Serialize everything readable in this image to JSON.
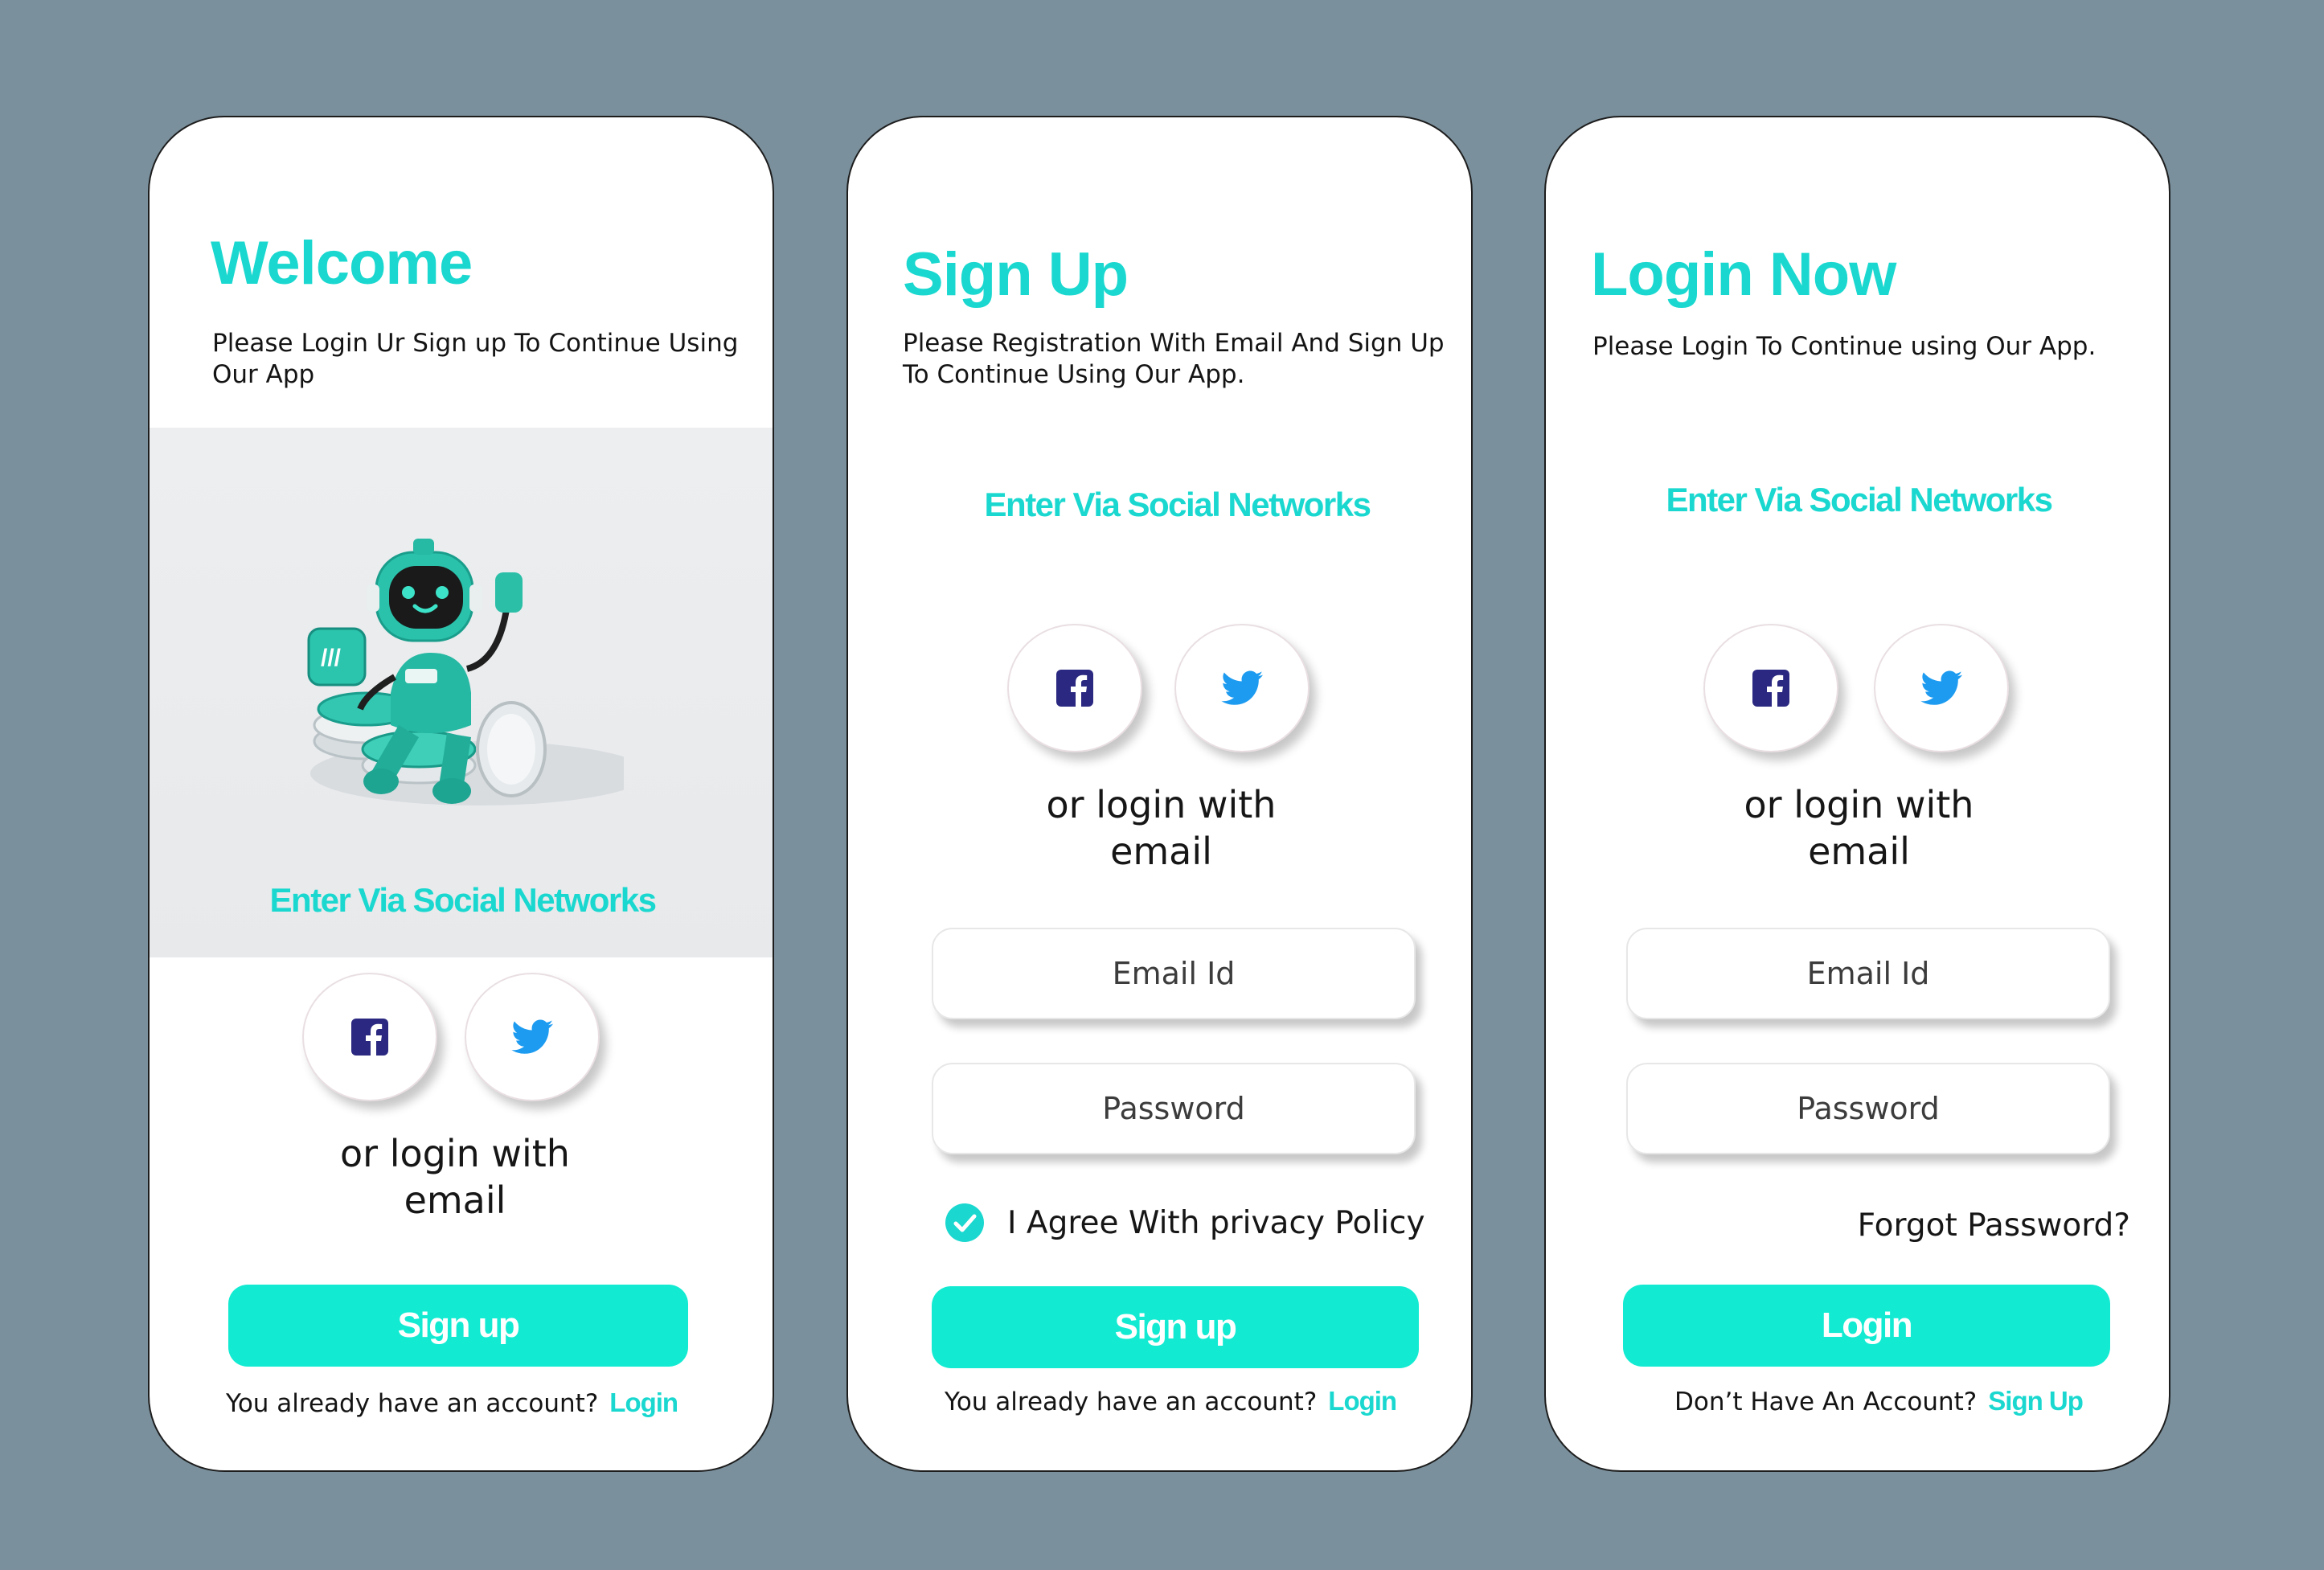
{
  "colors": {
    "background": "#7a909c",
    "accent": "#1ad8cf",
    "button": "#12ebd2",
    "facebook": "#2a2880",
    "twitter": "#1d9bf0"
  },
  "welcome": {
    "title": "Welcome",
    "subtitle": "Please Login Ur Sign up To Continue Using\nOur App",
    "hero_icon": "robot-mascot-illustration",
    "social_heading": "Enter Via Social Networks",
    "or_text": "or login with\nemail",
    "primary_button": "Sign up",
    "account_prompt": "You already have an account?",
    "account_link": "Login"
  },
  "signup": {
    "title": "Sign Up",
    "subtitle": "Please Registration With Email And Sign Up\nTo Continue Using Our App.",
    "social_heading": "Enter Via Social Networks",
    "or_text": "or login with\nemail",
    "email_placeholder": "Email Id",
    "password_placeholder": "Password",
    "agree_label": "I Agree With privacy Policy",
    "agree_checked": true,
    "primary_button": "Sign up",
    "account_prompt": "You already have an account?",
    "account_link": "Login"
  },
  "login": {
    "title": "Login Now",
    "subtitle": "Please Login To Continue using Our App.",
    "social_heading": "Enter Via Social Networks",
    "or_text": "or login with\nemail",
    "email_placeholder": "Email Id",
    "password_placeholder": "Password",
    "forgot_link": "Forgot Password?",
    "primary_button": "Login",
    "account_prompt": "Don’t Have An Account?",
    "account_link": "Sign Up"
  },
  "icons": {
    "facebook": "facebook-icon",
    "twitter": "twitter-icon",
    "check": "check-circle-icon"
  }
}
